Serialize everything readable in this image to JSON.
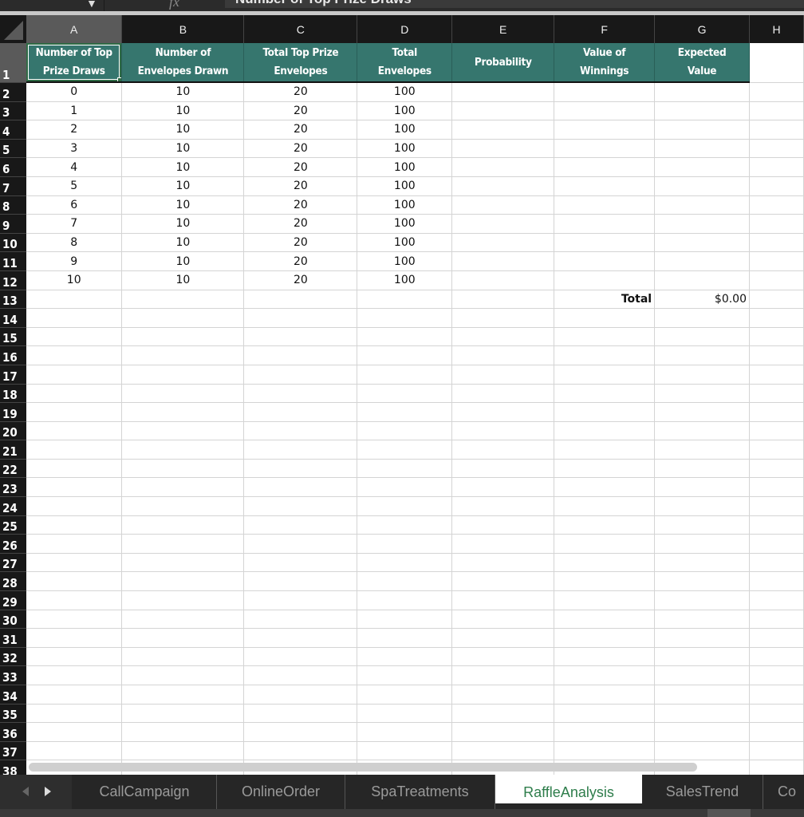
{
  "formula_bar": {
    "name_box_dropdown_icon": "triangle-down",
    "fx_label": "fx",
    "content": "Number of Top Prize Draws"
  },
  "columns": [
    "A",
    "B",
    "C",
    "D",
    "E",
    "F",
    "G",
    "H"
  ],
  "active_cell": "A1",
  "header_row": [
    "Number of Top Prize Draws",
    "Number of Envelopes Drawn",
    "Total  Top Prize Envelopes",
    "Total Envelopes",
    "Probability",
    "Value of Winnings",
    "Expected Value"
  ],
  "header_lines": [
    [
      "Number of Top",
      "Prize Draws"
    ],
    [
      "Number of",
      "Envelopes Drawn"
    ],
    [
      "Total  Top Prize",
      "Envelopes"
    ],
    [
      "Total",
      "Envelopes"
    ],
    [
      "Probability"
    ],
    [
      "Value of",
      "Winnings"
    ],
    [
      "Expected",
      "Value"
    ]
  ],
  "rows": [
    [
      "0",
      "10",
      "20",
      "100",
      "",
      "",
      ""
    ],
    [
      "1",
      "10",
      "20",
      "100",
      "",
      "",
      ""
    ],
    [
      "2",
      "10",
      "20",
      "100",
      "",
      "",
      ""
    ],
    [
      "3",
      "10",
      "20",
      "100",
      "",
      "",
      ""
    ],
    [
      "4",
      "10",
      "20",
      "100",
      "",
      "",
      ""
    ],
    [
      "5",
      "10",
      "20",
      "100",
      "",
      "",
      ""
    ],
    [
      "6",
      "10",
      "20",
      "100",
      "",
      "",
      ""
    ],
    [
      "7",
      "10",
      "20",
      "100",
      "",
      "",
      ""
    ],
    [
      "8",
      "10",
      "20",
      "100",
      "",
      "",
      ""
    ],
    [
      "9",
      "10",
      "20",
      "100",
      "",
      "",
      ""
    ],
    [
      "10",
      "10",
      "20",
      "100",
      "",
      "",
      ""
    ]
  ],
  "total_row": {
    "label": "Total",
    "value": "$0.00"
  },
  "visible_row_count": 38,
  "sheet_tabs": [
    "CallCampaign",
    "OnlineOrder",
    "SpaTreatments",
    "RaffleAnalysis",
    "SalesTrend",
    "Co"
  ],
  "active_tab": "RaffleAnalysis",
  "colors": {
    "header_fill": "#36766e",
    "active_tab_text": "#2e7d4b"
  }
}
